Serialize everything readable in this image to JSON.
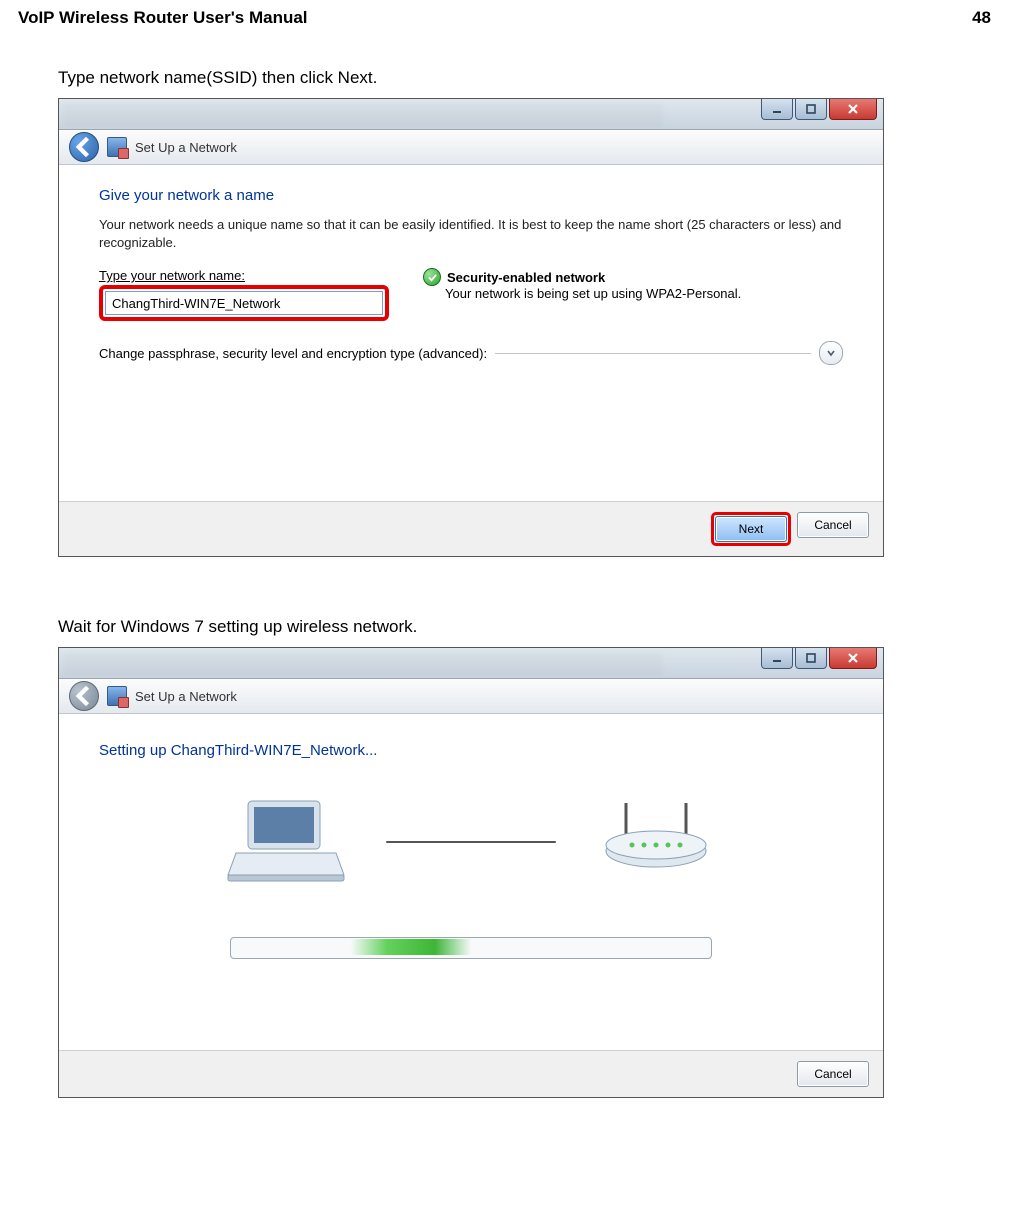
{
  "page_header": {
    "title": "VoIP Wireless Router User's Manual",
    "page_number": "48"
  },
  "intro1": "Type network name(SSID) then click Next.",
  "intro2": "Wait for Windows 7 setting up wireless network.",
  "win1": {
    "nav_title": "Set Up a Network",
    "section_title": "Give your network a name",
    "description": "Your network needs a unique name so that it can be easily identified. It is best to keep the name short (25 characters or less) and recognizable.",
    "field_label": "Type your network name:",
    "ssid_value": "ChangThird-WIN7E_Network",
    "sec_heading": "Security-enabled network",
    "sec_sub": "Your network is being set up using WPA2-Personal.",
    "advanced_label": "Change passphrase, security level and encryption type (advanced):",
    "next_label": "Next",
    "cancel_label": "Cancel"
  },
  "win2": {
    "nav_title": "Set Up a Network",
    "setup_title": "Setting up ChangThird-WIN7E_Network...",
    "cancel_label": "Cancel"
  }
}
